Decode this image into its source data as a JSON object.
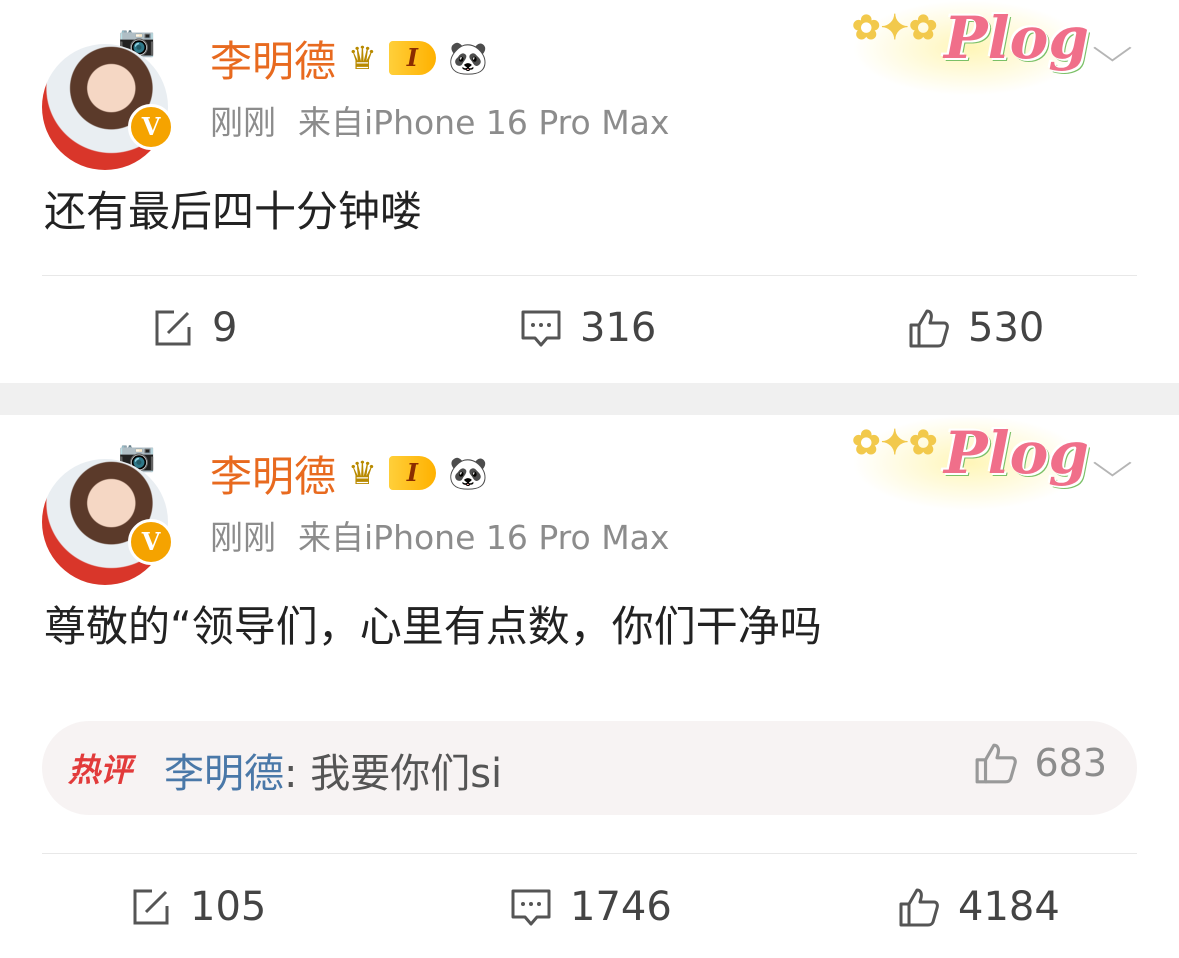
{
  "posts": [
    {
      "author": "李明德",
      "level_badge": "I",
      "time": "刚刚",
      "source": "来自iPhone 16 Pro Max",
      "sticker": "Plog",
      "text": "还有最后四十分钟喽",
      "reposts": "9",
      "comments": "316",
      "likes": "530"
    },
    {
      "author": "李明德",
      "level_badge": "I",
      "time": "刚刚",
      "source": "来自iPhone 16 Pro Max",
      "sticker": "Plog",
      "text": "尊敬的“领导们，心里有点数，你们干净吗",
      "hot_comment": {
        "tag": "热评",
        "user": "李明德",
        "separator": ":",
        "text": " 我要你们si",
        "likes": "683"
      },
      "reposts": "105",
      "comments": "1746",
      "likes": "4184"
    }
  ],
  "icons": {
    "repost": "repost-icon",
    "comment": "comment-icon",
    "like": "thumbs-up-icon",
    "more": "chevron-down-icon",
    "verified": "verified-v-icon",
    "crown": "crown-icon",
    "panda": "panda-icon"
  },
  "colors": {
    "author": "#e86a1f",
    "meta": "#8c8c8c",
    "hot_tag": "#e23b3b",
    "hot_user": "#4a78a8",
    "verified": "#f5a300"
  }
}
